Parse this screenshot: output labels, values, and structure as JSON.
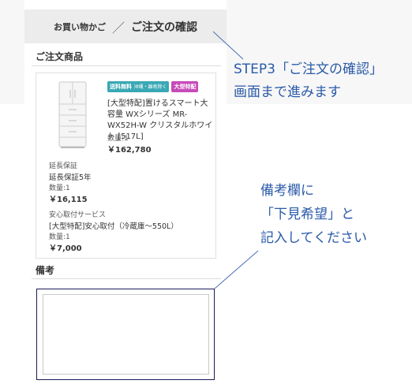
{
  "header": {
    "breadcrumb_cart": "お買い物かご",
    "breadcrumb_separator": "／",
    "breadcrumb_current": "ご注文の確認"
  },
  "order_items": {
    "section_title": "ご注文商品",
    "product": {
      "image_icon": "refrigerator-image",
      "badges": {
        "free_shipping": "送料無料",
        "region_note": "沖縄・離島除く",
        "large_item": "大型特配"
      },
      "name": "[大型特配]置けるスマート大容量 WXシリーズ MR-WX52H-W クリスタルホワイト [517L]",
      "quantity": "数量:1",
      "price": "￥162,780"
    },
    "extended_warranty": {
      "category": "延長保証",
      "name": "延長保証5年",
      "quantity": "数量:1",
      "price": "￥16,115"
    },
    "installation": {
      "category": "安心取付サービス",
      "name": "[大型特配]安心取付（冷蔵庫～550L）",
      "quantity": "数量:1",
      "price": "￥7,000"
    }
  },
  "remarks": {
    "section_title": "備考",
    "value": ""
  },
  "annotations": {
    "step_line1": "STEP3「ご注文の確認」",
    "step_line2": "画面まで進みます",
    "remarks_line1": "備考欄に",
    "remarks_line2": "「下見希望」と",
    "remarks_line3": "記入してください"
  },
  "colors": {
    "badge_teal": "#3aa8b5",
    "badge_pink": "#c74ab9",
    "callout_blue": "#2a5aa8",
    "header_bg": "#ececec"
  }
}
